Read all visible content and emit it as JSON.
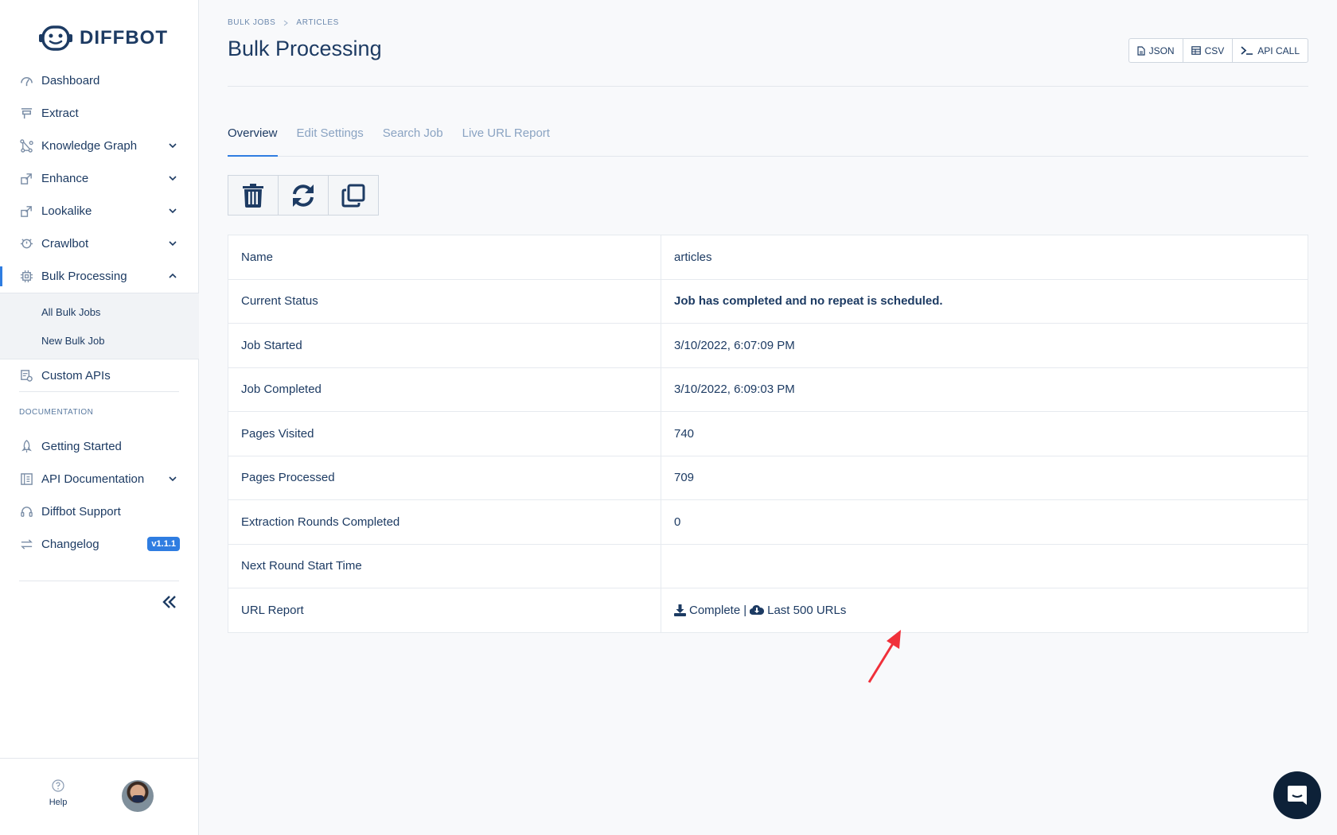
{
  "brand": {
    "name": "DIFFBOT"
  },
  "sidebar": {
    "items": [
      {
        "label": "Dashboard",
        "icon": "dashboard-icon"
      },
      {
        "label": "Extract",
        "icon": "extract-icon"
      },
      {
        "label": "Knowledge Graph",
        "icon": "knowledge-graph-icon"
      },
      {
        "label": "Enhance",
        "icon": "enhance-icon"
      },
      {
        "label": "Lookalike",
        "icon": "lookalike-icon"
      },
      {
        "label": "Crawlbot",
        "icon": "crawlbot-icon"
      },
      {
        "label": "Bulk Processing",
        "icon": "bulk-processing-icon"
      }
    ],
    "sub_items": [
      {
        "label": "All Bulk Jobs"
      },
      {
        "label": "New Bulk Job"
      }
    ],
    "custom_apis": {
      "label": "Custom APIs"
    },
    "documentation_title": "DOCUMENTATION",
    "docs": [
      {
        "label": "Getting Started"
      },
      {
        "label": "API Documentation"
      },
      {
        "label": "Diffbot Support"
      },
      {
        "label": "Changelog",
        "badge": "v1.1.1"
      }
    ],
    "help_label": "Help"
  },
  "breadcrumb": {
    "items": [
      "BULK JOBS",
      "ARTICLES"
    ]
  },
  "page": {
    "title": "Bulk Processing"
  },
  "export": {
    "json": "JSON",
    "csv": "CSV",
    "api": "API CALL"
  },
  "tabs": [
    "Overview",
    "Edit Settings",
    "Search Job",
    "Live URL Report"
  ],
  "job": {
    "rows": [
      {
        "label": "Name",
        "value": "articles"
      },
      {
        "label": "Current Status",
        "value": "Job has completed and no repeat is scheduled."
      },
      {
        "label": "Job Started",
        "value": "3/10/2022, 6:07:09 PM"
      },
      {
        "label": "Job Completed",
        "value": "3/10/2022, 6:09:03 PM"
      },
      {
        "label": "Pages Visited",
        "value": "740"
      },
      {
        "label": "Pages Processed",
        "value": "709"
      },
      {
        "label": "Extraction Rounds Completed",
        "value": "0"
      },
      {
        "label": "Next Round Start Time",
        "value": ""
      },
      {
        "label": "URL Report",
        "value": ""
      }
    ],
    "report_complete": "Complete",
    "report_separator": "|",
    "report_last": "Last 500 URLs"
  },
  "colors": {
    "accent": "#2f7de1",
    "text": "#1d3b63",
    "annotation_arrow": "#f0303a",
    "chat": "#0d2138"
  }
}
